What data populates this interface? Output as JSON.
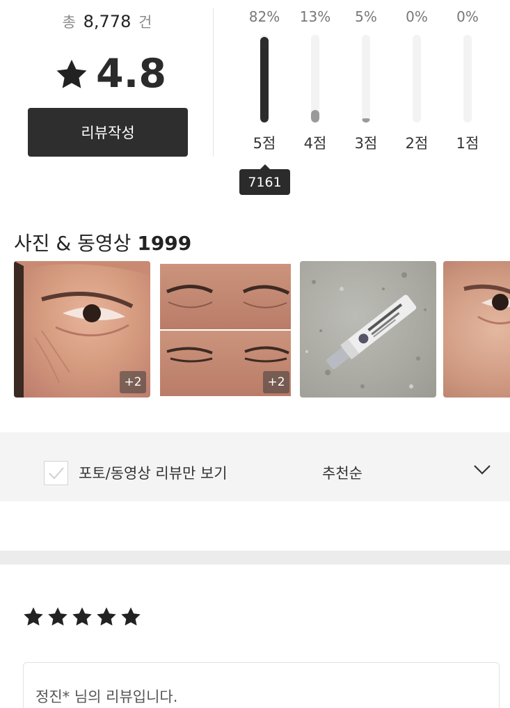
{
  "summary": {
    "total_prefix": "총",
    "total_count": "8,778",
    "total_suffix": "건",
    "average": "4.8",
    "write_button": "리뷰작성",
    "distribution": [
      {
        "label": "5점",
        "percent": "82%",
        "fraction": 0.82
      },
      {
        "label": "4점",
        "percent": "13%",
        "fraction": 0.13
      },
      {
        "label": "3점",
        "percent": "5%",
        "fraction": 0.05
      },
      {
        "label": "2점",
        "percent": "0%",
        "fraction": 0.0
      },
      {
        "label": "1점",
        "percent": "0%",
        "fraction": 0.0
      }
    ],
    "tooltip": "7161"
  },
  "photos": {
    "title": "사진 & 동영상",
    "count": "1999",
    "items": [
      {
        "more": "+2",
        "icon": "face-eye-photo"
      },
      {
        "more": "+2",
        "icon": "closed-eyes-photo"
      },
      {
        "more": "",
        "icon": "eye-cream-tube-photo"
      },
      {
        "more": "",
        "icon": "face-eye-photo"
      }
    ]
  },
  "filter": {
    "photo_only_label": "포토/동영상 리뷰만 보기",
    "sort_label": "추천순"
  },
  "review": {
    "rating": 5,
    "author_text": "정진* 님의 리뷰입니다."
  },
  "colors": {
    "primary_dark": "#2e2e2e",
    "bar_light": "#9a9a9a",
    "track": "#f3f3f3",
    "filter_bg": "#f4f4f4"
  }
}
